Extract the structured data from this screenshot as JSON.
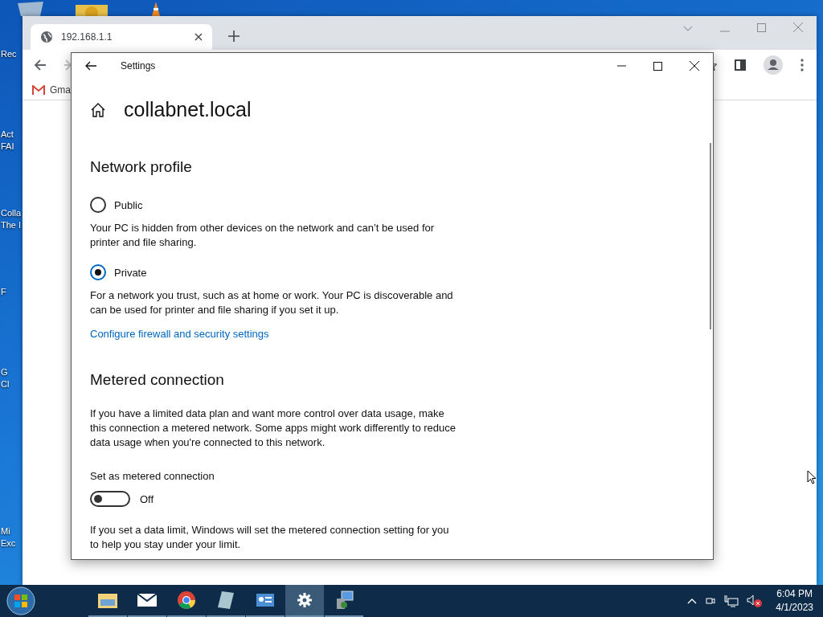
{
  "desktop": {
    "icons": [
      {
        "lines": [
          "Rec"
        ]
      },
      {
        "lines": [
          "Act",
          "FAI"
        ]
      },
      {
        "lines": [
          "Colla",
          "The I"
        ]
      },
      {
        "lines": [
          "F"
        ]
      },
      {
        "lines": [
          "G",
          "Cl"
        ]
      },
      {
        "lines": [
          "Mi",
          "Exc"
        ]
      }
    ]
  },
  "browser": {
    "tab": {
      "title": "192.168.1.1"
    },
    "bookmarks": [
      {
        "label": "Gma"
      }
    ]
  },
  "settings": {
    "window": {
      "title": "Settings"
    },
    "page_title": "collabnet.local",
    "network_profile": {
      "heading": "Network profile",
      "options": [
        {
          "label": "Public",
          "selected": false,
          "description": "Your PC is hidden from other devices on the network and can’t be used for printer and file sharing."
        },
        {
          "label": "Private",
          "selected": true,
          "description": "For a network you trust, such as at home or work. Your PC is discoverable and can be used for printer and file sharing if you set it up."
        }
      ],
      "link": "Configure firewall and security settings"
    },
    "metered": {
      "heading": "Metered connection",
      "description": "If you have a limited data plan and want more control over data usage, make this connection a metered network. Some apps might work differently to reduce data usage when you're connected to this network.",
      "toggle_label": "Set as metered connection",
      "toggle": {
        "on": false,
        "state_text": "Off"
      },
      "note": "If you set a data limit, Windows will set the metered connection setting for you to help you stay under your limit."
    }
  },
  "taskbar": {
    "apps": [
      {
        "kind": "folder",
        "active": false
      },
      {
        "kind": "mail",
        "active": false
      },
      {
        "kind": "chrome",
        "active": false
      },
      {
        "kind": "notepad",
        "active": false
      },
      {
        "kind": "panel",
        "active": false
      },
      {
        "kind": "gear",
        "active": true
      },
      {
        "kind": "installer",
        "active": false
      }
    ],
    "clock": {
      "time": "6:04 PM",
      "date": "4/1/2023"
    }
  }
}
